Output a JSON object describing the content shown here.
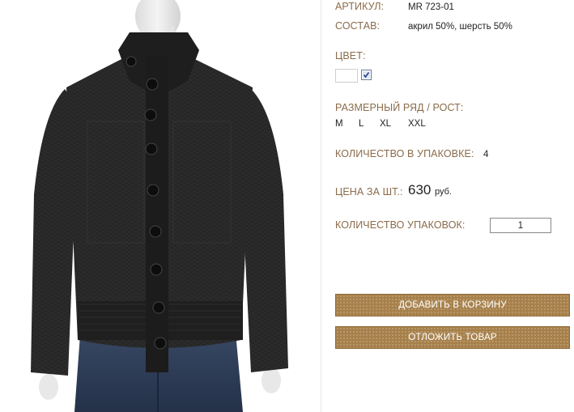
{
  "product": {
    "article_label": "АРТИКУЛ:",
    "article_value": "MR 723-01",
    "composition_label": "СОСТАВ:",
    "composition_value": "акрил 50%, шерсть 50%",
    "color_label": "ЦВЕТ:",
    "size_label": "РАЗМЕРНЫЙ РЯД / РОСТ:",
    "sizes": [
      "M",
      "L",
      "XL",
      "XXL"
    ],
    "pack_qty_label": "КОЛИЧЕСТВО В УПАКОВКЕ:",
    "pack_qty_value": "4",
    "price_label": "ЦЕНА ЗА ШТ.:",
    "price_value": "630",
    "price_currency": "руб.",
    "packs_label": "КОЛИЧЕСТВО УПАКОВОК:",
    "packs_value": "1"
  },
  "buttons": {
    "add_to_cart": "ДОБАВИТЬ В КОРЗИНУ",
    "postpone": "ОТЛОЖИТЬ ТОВАР"
  },
  "colors": {
    "label": "#8a6b4a",
    "button": "#a7804a",
    "sweater": "#232323"
  },
  "icons": {
    "color_checkbox": "checkbox-checked-icon"
  }
}
